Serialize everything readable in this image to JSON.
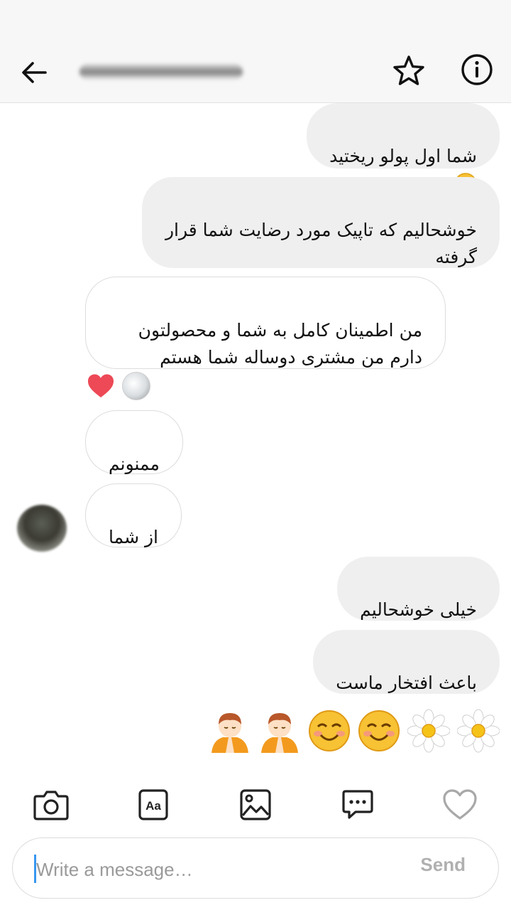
{
  "header": {
    "back_icon": "arrow-left-icon",
    "star_icon": "star-icon",
    "info_icon": "info-icon"
  },
  "messages": [
    {
      "direction": "outgoing",
      "text": "شما اول پولو ریختید",
      "emoji": "smiling-face-emoji"
    },
    {
      "direction": "outgoing",
      "text": "خوشحالیم که تاپیک مورد رضایت شما قرار گرفته"
    },
    {
      "direction": "incoming",
      "text": "من اطمینان کامل به شما و محصولتون دارم من مشتری دوساله شما هستم"
    },
    {
      "direction": "incoming",
      "text": "ممنونم"
    },
    {
      "direction": "incoming",
      "text": "از شما"
    },
    {
      "direction": "outgoing",
      "text": "خیلی خوشحالیم"
    },
    {
      "direction": "outgoing",
      "text": "باعث افتخار ماست"
    }
  ],
  "reactions": [
    "heart-icon",
    "reactor-avatar"
  ],
  "emoji_message": [
    "daisy-emoji",
    "daisy-emoji",
    "smiling-face-emoji",
    "smiling-face-emoji",
    "praying-boy-emoji",
    "praying-boy-emoji"
  ],
  "composer": {
    "tools": [
      "camera-icon",
      "text-style-icon",
      "gallery-icon",
      "quick-reply-icon",
      "heart-outline-icon"
    ],
    "text_tool_label": "Aa",
    "placeholder": "Write a message…",
    "send_label": "Send"
  },
  "colors": {
    "outgoing_bubble": "#efefef",
    "incoming_border": "#dcdcdc",
    "heart": "#ed4956",
    "caret": "#3897f0"
  }
}
